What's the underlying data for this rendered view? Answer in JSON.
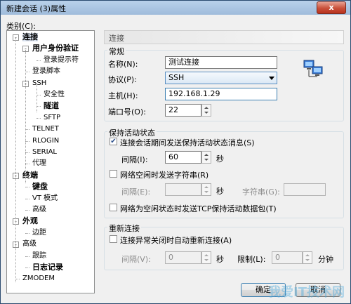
{
  "window": {
    "title": "新建会话 (3)属性",
    "close_label": "x"
  },
  "category_label": "类别(C):",
  "tree": [
    {
      "label": "连接",
      "bold": true,
      "selected": true,
      "level": 0
    },
    {
      "label": "用户身份验证",
      "bold": true,
      "level": 1
    },
    {
      "label": "登录提示符",
      "level": 2
    },
    {
      "label": "登录脚本",
      "level": 1
    },
    {
      "label": "SSH",
      "level": 1
    },
    {
      "label": "安全性",
      "level": 2
    },
    {
      "label": "隧道",
      "bold": true,
      "level": 2
    },
    {
      "label": "SFTP",
      "level": 2
    },
    {
      "label": "TELNET",
      "level": 1
    },
    {
      "label": "RLOGIN",
      "level": 1
    },
    {
      "label": "SERIAL",
      "level": 1
    },
    {
      "label": "代理",
      "level": 1
    },
    {
      "label": "终端",
      "bold": true,
      "level": 0
    },
    {
      "label": "键盘",
      "bold": true,
      "level": 1
    },
    {
      "label": "VT 模式",
      "level": 1
    },
    {
      "label": "高级",
      "level": 1
    },
    {
      "label": "外观",
      "bold": true,
      "level": 0
    },
    {
      "label": "边距",
      "level": 1
    },
    {
      "label": "高级",
      "level": 0
    },
    {
      "label": "跟踪",
      "level": 1
    },
    {
      "label": "日志记录",
      "bold": true,
      "level": 1
    },
    {
      "label": "ZMODEM",
      "level": 0
    }
  ],
  "panel_title": "连接",
  "general": {
    "group_label": "常规",
    "name_label": "名称(N):",
    "name_value": "测试连接",
    "protocol_label": "协议(P):",
    "protocol_value": "SSH",
    "host_label": "主机(H):",
    "host_value": "192.168.1.29",
    "port_label": "端口号(O):",
    "port_value": "22"
  },
  "keepalive": {
    "group_label": "保持活动状态",
    "send_msg_label": "连接会话期间发送保持活动状态消息(S)",
    "send_msg_checked": true,
    "interval_label": "间隔(I):",
    "interval_value": "60",
    "sec_label": "秒",
    "send_str_label": "网络空闲时发送字符串(R)",
    "send_str_checked": false,
    "interval2_label": "间隔(E):",
    "interval2_value": "",
    "sec2_label": "秒",
    "string_label": "字符串(G):",
    "string_value": "",
    "tcp_label": "网络为空闲状态时发送TCP保持活动数据包(T)",
    "tcp_checked": false
  },
  "reconnect": {
    "group_label": "重新连接",
    "auto_label": "连接异常关闭时自动重新连接(A)",
    "auto_checked": false,
    "interval_label": "间隔(V):",
    "interval_value": "0",
    "sec_label": "秒",
    "limit_label": "限制(L):",
    "limit_value": "0",
    "min_label": "分钟"
  },
  "buttons": {
    "ok": "确定",
    "cancel": "取消"
  },
  "watermark": "我爱IT技术网"
}
